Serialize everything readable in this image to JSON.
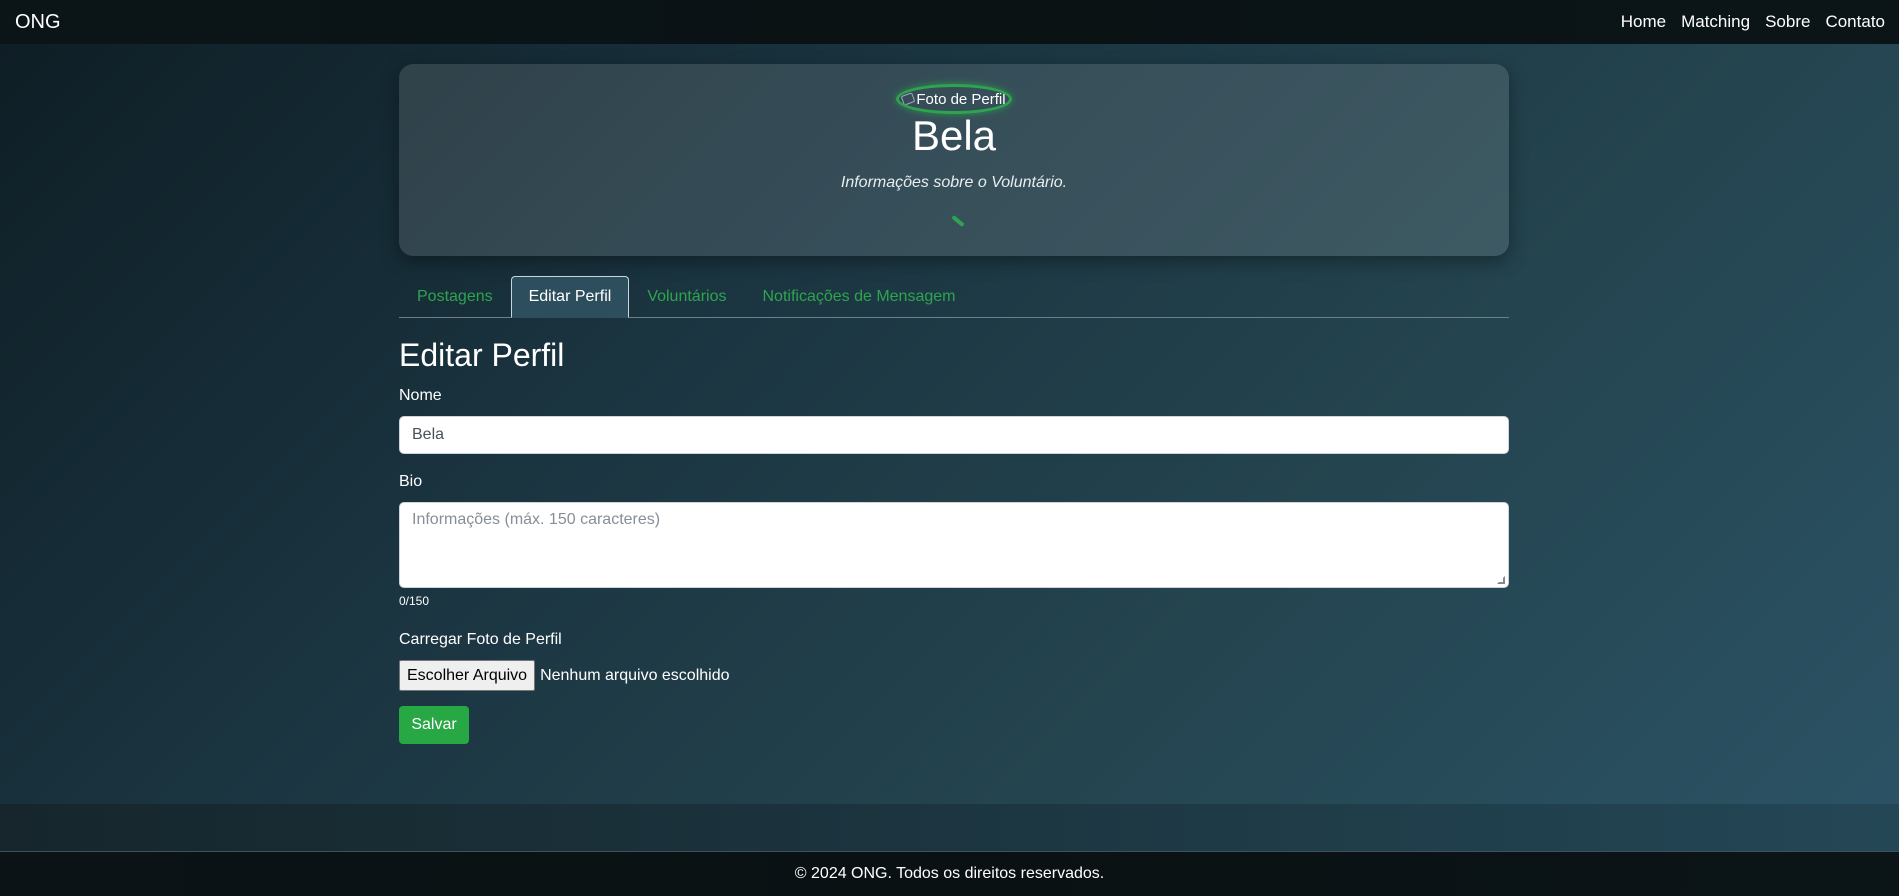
{
  "navbar": {
    "brand": "ONG",
    "links": [
      "Home",
      "Matching",
      "Sobre",
      "Contato"
    ]
  },
  "profile": {
    "avatar_alt": "Foto de Perfil",
    "name": "Bela",
    "bio": "Informações sobre o Voluntário."
  },
  "tabs": [
    {
      "label": "Postagens",
      "active": false
    },
    {
      "label": "Editar Perfil",
      "active": true
    },
    {
      "label": "Voluntários",
      "active": false
    },
    {
      "label": "Notificações de Mensagem",
      "active": false
    }
  ],
  "form": {
    "title": "Editar Perfil",
    "name_label": "Nome",
    "name_value": "Bela",
    "bio_label": "Bio",
    "bio_placeholder": "Informações (máx. 150 caracteres)",
    "bio_counter": "0/150",
    "photo_label": "Carregar Foto de Perfil",
    "file_button": "Escolher Arquivo",
    "file_status": "Nenhum arquivo escolhido",
    "save_label": "Salvar"
  },
  "footer": {
    "text": "© 2024 ONG. Todos os direitos reservados."
  },
  "colors": {
    "accent": "#28a745",
    "navbar": "#0a1214",
    "active_tab": "#2d4e5c"
  }
}
